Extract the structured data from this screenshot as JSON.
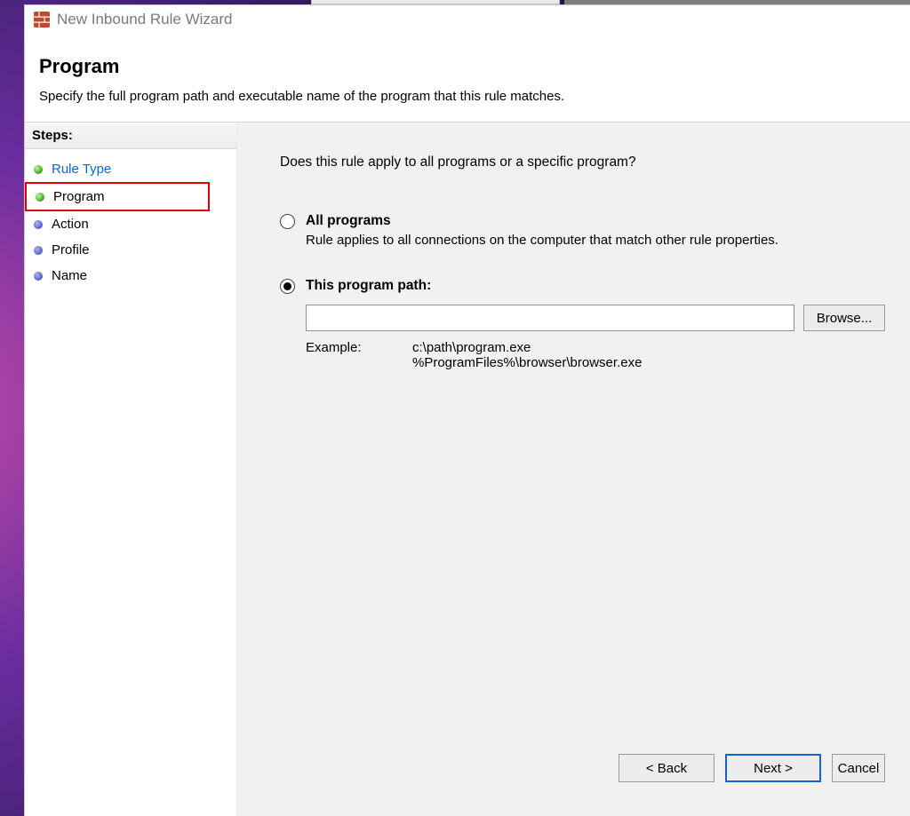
{
  "window": {
    "title": "New Inbound Rule Wizard"
  },
  "page": {
    "heading": "Program",
    "description": "Specify the full program path and executable name of the program that this rule matches."
  },
  "steps": {
    "header": "Steps:",
    "items": [
      {
        "label": "Rule Type",
        "state": "done"
      },
      {
        "label": "Program",
        "state": "current"
      },
      {
        "label": "Action",
        "state": "pending"
      },
      {
        "label": "Profile",
        "state": "pending"
      },
      {
        "label": "Name",
        "state": "pending"
      }
    ]
  },
  "content": {
    "question": "Does this rule apply to all programs or a specific program?",
    "options": {
      "all": {
        "title": "All programs",
        "description": "Rule applies to all connections on the computer that match other rule properties.",
        "selected": false
      },
      "path": {
        "title": "This program path:",
        "selected": true,
        "value": "",
        "browse_label": "Browse...",
        "example_label": "Example:",
        "example_values": "c:\\path\\program.exe\n%ProgramFiles%\\browser\\browser.exe"
      }
    }
  },
  "buttons": {
    "back": "< Back",
    "next": "Next >",
    "cancel": "Cancel"
  }
}
